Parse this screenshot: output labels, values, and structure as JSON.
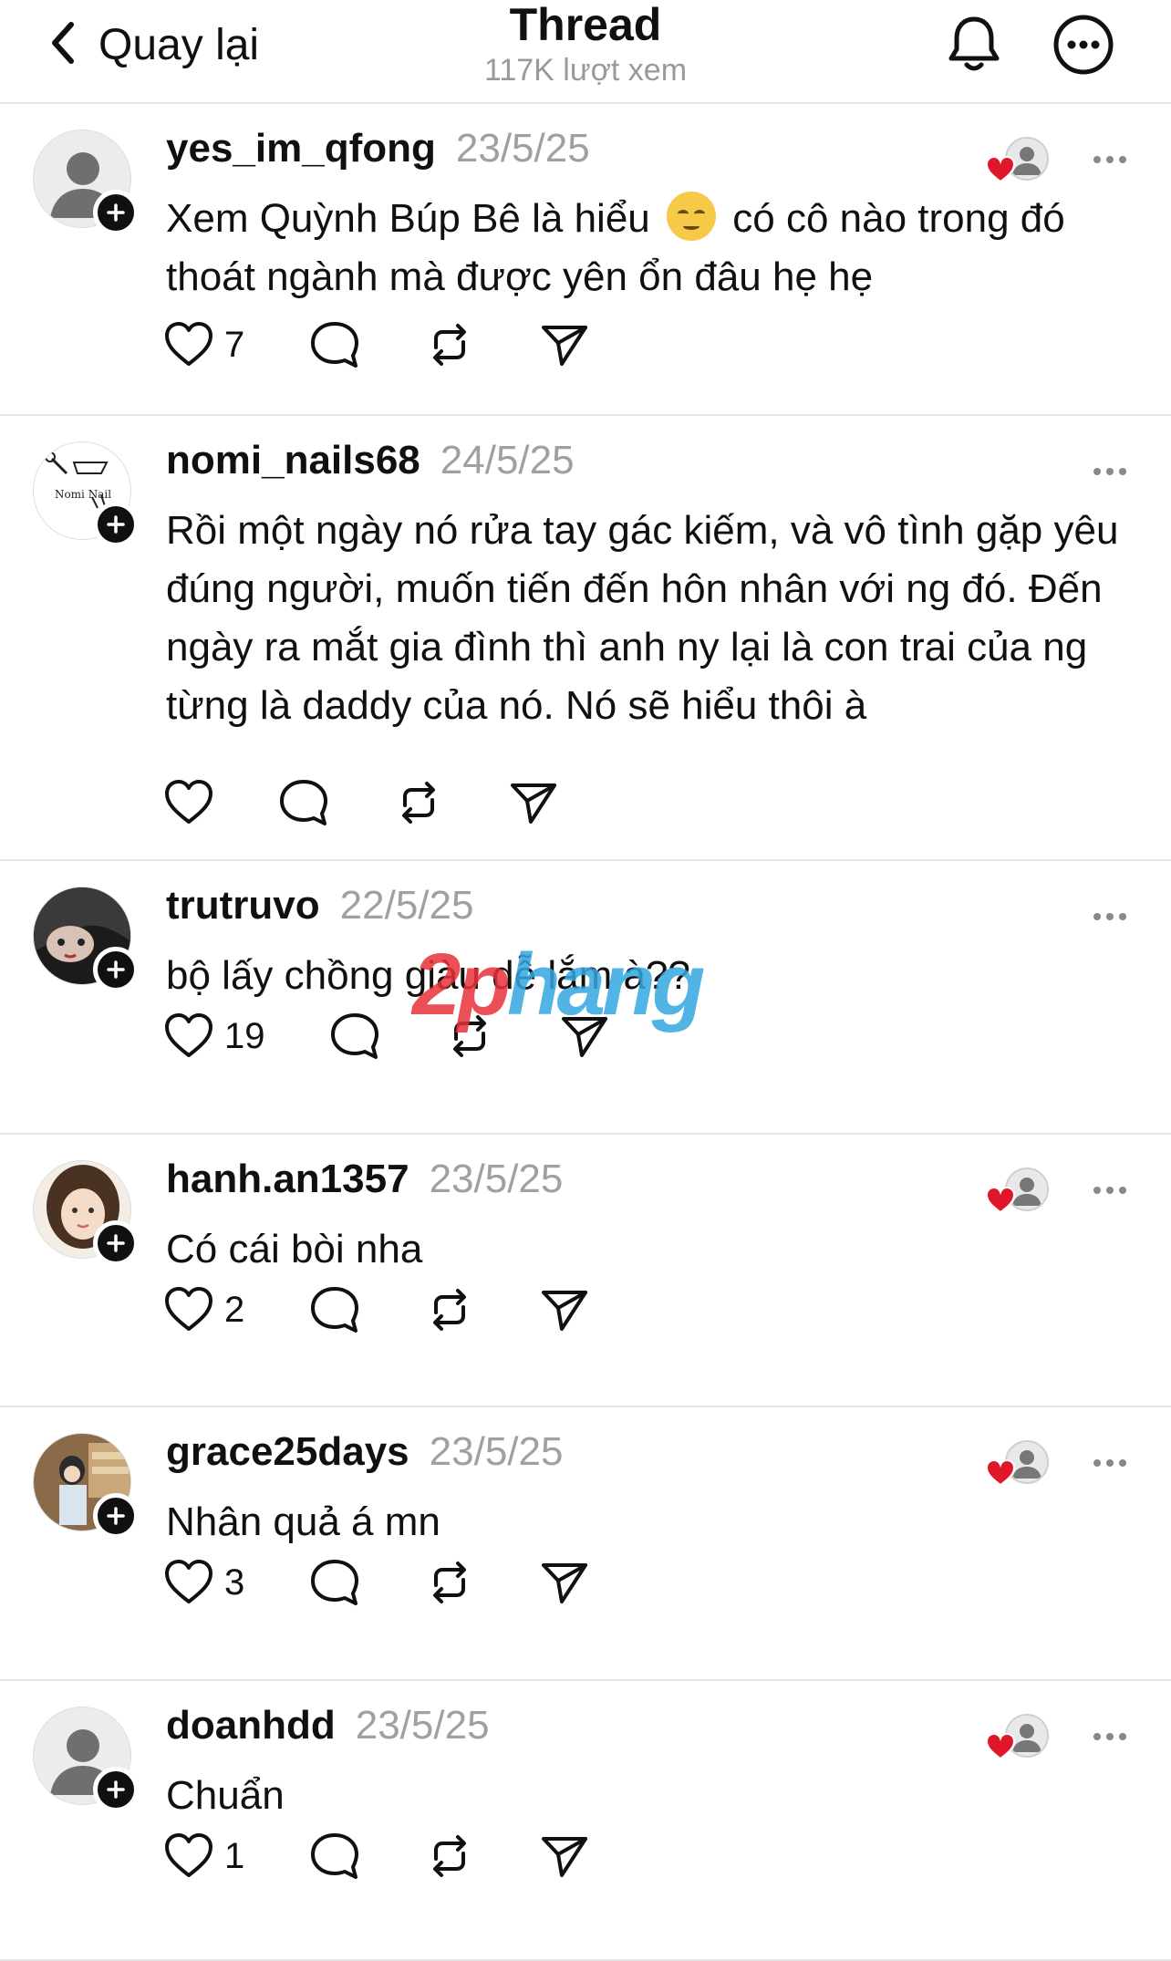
{
  "header": {
    "back_label": "Quay lại",
    "title": "Thread",
    "views": "117K lượt xem"
  },
  "icons": {
    "back": "chevron-left-icon",
    "notifications": "bell-icon",
    "more": "more-circle-icon",
    "like": "heart-icon",
    "reply": "speech-bubble-icon",
    "repost": "repost-icon",
    "share": "paper-plane-icon",
    "follow": "plus-icon",
    "options": "ellipsis-icon"
  },
  "colors": {
    "like_heart": "#e0162b",
    "muted_text": "#a0a0a0",
    "text": "#101010"
  },
  "comments": [
    {
      "username": "yes_im_qfong",
      "date": "23/5/25",
      "text_before": "Xem Quỳnh Búp Bê là hiểu",
      "emoji": "relieved-face-emoji",
      "text_after": "có cô nào trong đó thoát ngành mà được yên ổn đâu hẹ hẹ",
      "likes": "7",
      "liked_by_author": true,
      "avatar": "default"
    },
    {
      "username": "nomi_nails68",
      "date": "24/5/25",
      "text": "Rồi một ngày nó rửa tay gác kiếm, và vô tình gặp yêu đúng người, muốn tiến đến hôn nhân với ng đó. Đến ngày ra mắt gia đình thì anh ny lại là con trai của ng từng là daddy của nó. Nó sẽ hiểu thôi à",
      "likes": "",
      "liked_by_author": false,
      "avatar": "logo",
      "avatar_logo_text": "Nomi Nail"
    },
    {
      "username": "trutruvo",
      "date": "22/5/25",
      "text": "bộ lấy chồng giàu dễ lắm à??",
      "likes": "19",
      "liked_by_author": false,
      "avatar": "photo-dark"
    },
    {
      "username": "hanh.an1357",
      "date": "23/5/25",
      "text": "Có cái bòi nha",
      "likes": "2",
      "liked_by_author": true,
      "avatar": "photo-light"
    },
    {
      "username": "grace25days",
      "date": "23/5/25",
      "text": "Nhân quả á mn",
      "likes": "3",
      "liked_by_author": true,
      "avatar": "photo-room"
    },
    {
      "username": "doanhdd",
      "date": "23/5/25",
      "text": "Chuẩn",
      "likes": "1",
      "liked_by_author": true,
      "avatar": "default"
    }
  ],
  "watermark": {
    "part1": "2p",
    "part2": "hang"
  }
}
